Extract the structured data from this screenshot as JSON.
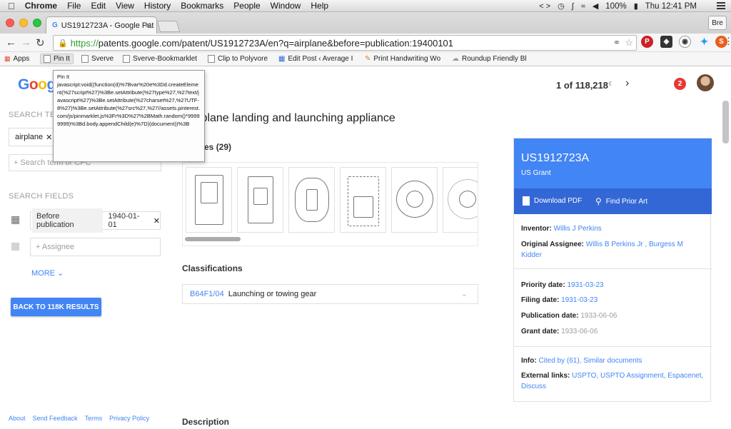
{
  "menubar": {
    "app": "Chrome",
    "items": [
      "File",
      "Edit",
      "View",
      "History",
      "Bookmarks",
      "People",
      "Window",
      "Help"
    ],
    "battery": "100%",
    "clock": "Thu 12:41 PM"
  },
  "tab": {
    "title": "US1912723A - Google Pat",
    "profile": "Bre"
  },
  "omnibox": {
    "scheme": "https://",
    "url": "patents.google.com/patent/US1912723A/en?q=airplane&before=publication:19400101"
  },
  "bookmarks": [
    "Apps",
    "Pin It",
    "Sverve",
    "Sverve-Bookmarklet",
    "Clip to Polyvore",
    "Edit Post ‹ Average I",
    "Print Handwriting Wo",
    "Roundup Friendly Bl"
  ],
  "tooltip": {
    "text": "Pin It\njavascript:void((function(d)%7Bvar%20e%3Dd.createElement(%27script%27)%3Be.setAttribute(%27type%27,%27text/javascript%27)%3Be.setAttribute(%27charset%27,%27UTF-8%27)%3Be.setAttribute(%27src%27,%27//assets.pinterest.com/js/pinmarklet.js%3Fr%3D%27%2BMath.random()*99999999)%3Bd.body.appendChild(e)%7D)(document))%3B"
  },
  "header": {
    "logo": "Google",
    "pager": "1 of 118,218",
    "notifications": "2"
  },
  "sidebar": {
    "search_terms_label": "SEARCH TERMS",
    "term_chip": "airplane",
    "term_placeholder": "+ Search term or CPC",
    "search_fields_label": "SEARCH FIELDS",
    "field_key": "Before publication",
    "field_value": "1940-01-01",
    "assignee_placeholder": "+ Assignee",
    "more": "MORE",
    "back_button": "BACK TO 118K RESULTS",
    "footer": [
      "About",
      "Send Feedback",
      "Terms",
      "Privacy Policy"
    ]
  },
  "main": {
    "title": "Airplane landing and launching appliance",
    "images_heading": "Images (29)",
    "classifications_heading": "Classifications",
    "class_code": "B64F1/04",
    "class_desc": "Launching or towing gear",
    "description_heading": "Description"
  },
  "card": {
    "patent_number": "US1912723A",
    "grant_type": "US Grant",
    "download_pdf": "Download PDF",
    "find_prior_art": "Find Prior Art",
    "inventor_label": "Inventor:",
    "inventor": "Willis J Perkins",
    "assignee_label": "Original Assignee:",
    "assignee": "Willis B Perkins Jr , Burgess M Kidder",
    "priority_label": "Priority date:",
    "priority_date": "1931-03-23",
    "filing_label": "Filing date:",
    "filing_date": "1931-03-23",
    "publication_label": "Publication date:",
    "publication_date": "1933-06-06",
    "grant_label": "Grant date:",
    "grant_date": "1933-06-06",
    "info_label": "Info:",
    "info_links": "Cited by (61), Similar documents",
    "external_label": "External links:",
    "external_links": "USPTO, USPTO Assignment, Espacenet, Discuss"
  },
  "colors": {
    "accent": "#4285f4",
    "accent_dark": "#3367d6",
    "badge": "#e53935"
  }
}
